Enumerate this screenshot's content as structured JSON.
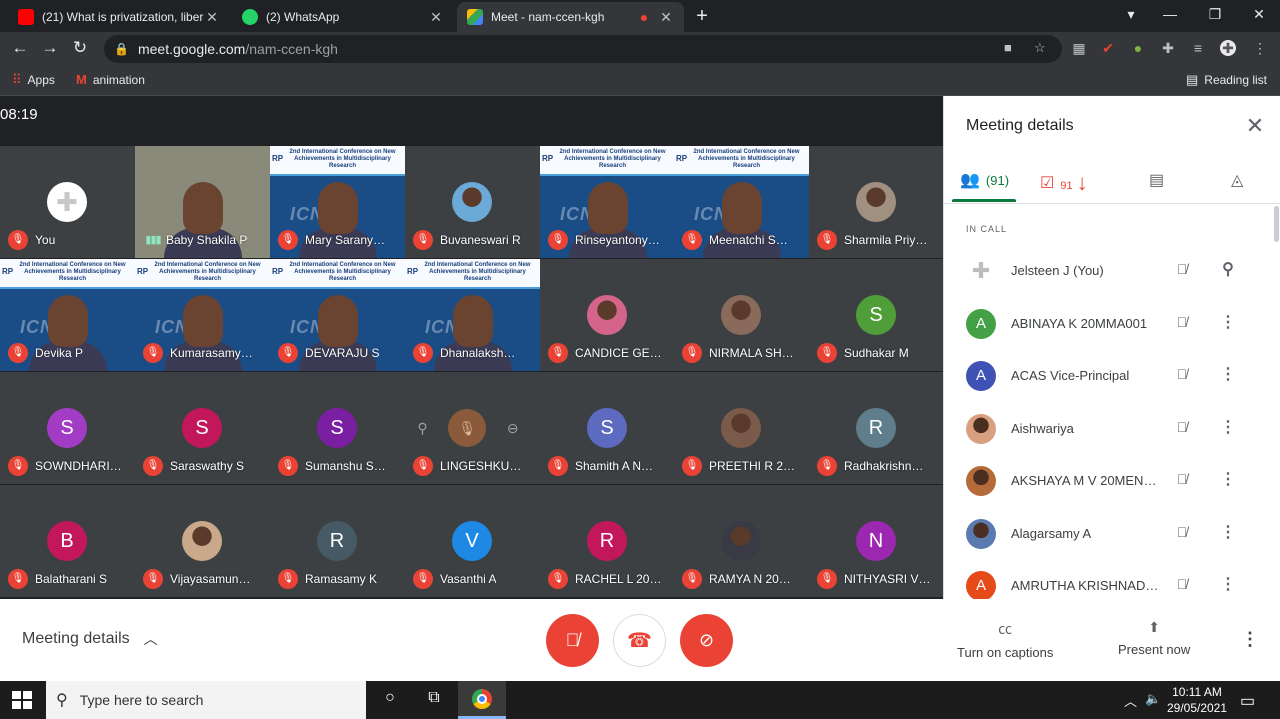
{
  "browser": {
    "tabs": [
      {
        "title": "(21) What is privatization, liberaliz",
        "favicon": "youtube-icon",
        "color": "#ff0000"
      },
      {
        "title": "(2) WhatsApp",
        "favicon": "whatsapp-icon",
        "color": "#25d366"
      },
      {
        "title": "Meet - nam-ccen-kgh",
        "favicon": "meet-icon",
        "color": "#00832d"
      }
    ],
    "url_host": "meet.google.com",
    "url_path": "/nam-ccen-kgh",
    "bookmarks": {
      "apps": "Apps",
      "animation": "animation",
      "reading_list": "Reading list"
    }
  },
  "meet": {
    "time": "08:19",
    "banner_text": "2nd International Conference on New Achievements in Multidisciplinary Research",
    "banner_logo": "RP",
    "video_watermark": "ICN",
    "tiles": [
      {
        "name": "You",
        "kind": "avatar",
        "icon": "cross-avatar-icon",
        "color": "#ffffff",
        "muted": true
      },
      {
        "name": "Baby Shakila P",
        "kind": "video",
        "muted": false,
        "speaking": true
      },
      {
        "name": "Mary Sarany…",
        "kind": "video",
        "banner": true,
        "muted": true
      },
      {
        "name": "Buvaneswari R",
        "kind": "photo",
        "color": "#6aa9d8",
        "muted": true
      },
      {
        "name": "Rinseyantony…",
        "kind": "video",
        "banner": true,
        "muted": true
      },
      {
        "name": "Meenatchi S…",
        "kind": "video",
        "banner": true,
        "muted": true
      },
      {
        "name": "Sharmila Priy…",
        "kind": "photo",
        "color": "#a09080",
        "muted": true
      },
      {
        "name": "Devika P",
        "kind": "video",
        "banner": true,
        "muted": true
      },
      {
        "name": "Kumarasamy…",
        "kind": "video",
        "banner": true,
        "muted": true
      },
      {
        "name": "DEVARAJU S",
        "kind": "video",
        "banner": true,
        "muted": true
      },
      {
        "name": "Dhanalaksh…",
        "kind": "video",
        "banner": true,
        "muted": true
      },
      {
        "name": "CANDICE GE…",
        "kind": "photo",
        "color": "#d4648a",
        "muted": true
      },
      {
        "name": "NIRMALA SH…",
        "kind": "photo",
        "color": "#8a6a5a",
        "muted": true
      },
      {
        "name": "Sudhakar M",
        "kind": "avatar",
        "letter": "S",
        "color": "#4f9e3a",
        "muted": true
      },
      {
        "name": "SOWNDHARI…",
        "kind": "avatar",
        "letter": "S",
        "color": "#a33cc4",
        "muted": true
      },
      {
        "name": "Saraswathy S",
        "kind": "avatar",
        "letter": "S",
        "color": "#c2185b",
        "muted": true
      },
      {
        "name": "Sumanshu S…",
        "kind": "avatar",
        "letter": "S",
        "color": "#7b1fa2",
        "muted": true
      },
      {
        "name": "LINGESHKU…",
        "kind": "hover",
        "muted": true
      },
      {
        "name": "Shamith A N…",
        "kind": "avatar",
        "letter": "S",
        "color": "#5c6bc0",
        "muted": true
      },
      {
        "name": "PREETHI R 2…",
        "kind": "photo",
        "color": "#7a5a4a",
        "muted": true
      },
      {
        "name": "Radhakrishn…",
        "kind": "avatar",
        "letter": "R",
        "color": "#607d8b",
        "muted": true
      },
      {
        "name": "Balatharani S",
        "kind": "avatar",
        "letter": "B",
        "color": "#c2185b",
        "muted": true
      },
      {
        "name": "Vijayasamun…",
        "kind": "photo",
        "color": "#c9a98a",
        "muted": true
      },
      {
        "name": "Ramasamy K",
        "kind": "avatar",
        "letter": "R",
        "color": "#455a64",
        "muted": true
      },
      {
        "name": "Vasanthi A",
        "kind": "avatar",
        "letter": "V",
        "color": "#1e88e5",
        "muted": true
      },
      {
        "name": "RACHEL L 20…",
        "kind": "avatar",
        "letter": "R",
        "color": "#c2185b",
        "muted": true
      },
      {
        "name": "RAMYA N 20…",
        "kind": "photo",
        "color": "#3a3a44",
        "muted": true
      },
      {
        "name": "NITHYASRI V…",
        "kind": "avatar",
        "letter": "N",
        "color": "#9c27b0",
        "muted": true
      }
    ]
  },
  "panel": {
    "title": "Meeting details",
    "people_count": "(91)",
    "activity_count": "91",
    "section": "IN CALL",
    "people": [
      {
        "name": "Jelsteen J (You)",
        "kind": "cross",
        "color": "#e8eaed",
        "action": "pin-icon"
      },
      {
        "name": "ABINAYA K 20MMA001",
        "letter": "A",
        "color": "#43a047",
        "action": "more-icon"
      },
      {
        "name": "ACAS Vice-Principal",
        "letter": "A",
        "color": "#3f51b5",
        "action": "more-icon"
      },
      {
        "name": "Aishwariya",
        "kind": "photo",
        "color": "#d9a080",
        "action": "more-icon"
      },
      {
        "name": "AKSHAYA M V 20MEN0…",
        "kind": "photo",
        "color": "#b56a3a",
        "action": "more-icon"
      },
      {
        "name": "Alagarsamy A",
        "kind": "photo",
        "color": "#5a7ab0",
        "action": "more-icon"
      },
      {
        "name": "AMRUTHA KRISHNADA…",
        "letter": "A",
        "color": "#e64a19",
        "action": "more-icon"
      }
    ]
  },
  "controls": {
    "meeting_details": "Meeting details",
    "captions": "Turn on captions",
    "present": "Present now"
  },
  "taskbar": {
    "search_placeholder": "Type here to search",
    "time": "10:11 AM",
    "date": "29/05/2021"
  }
}
